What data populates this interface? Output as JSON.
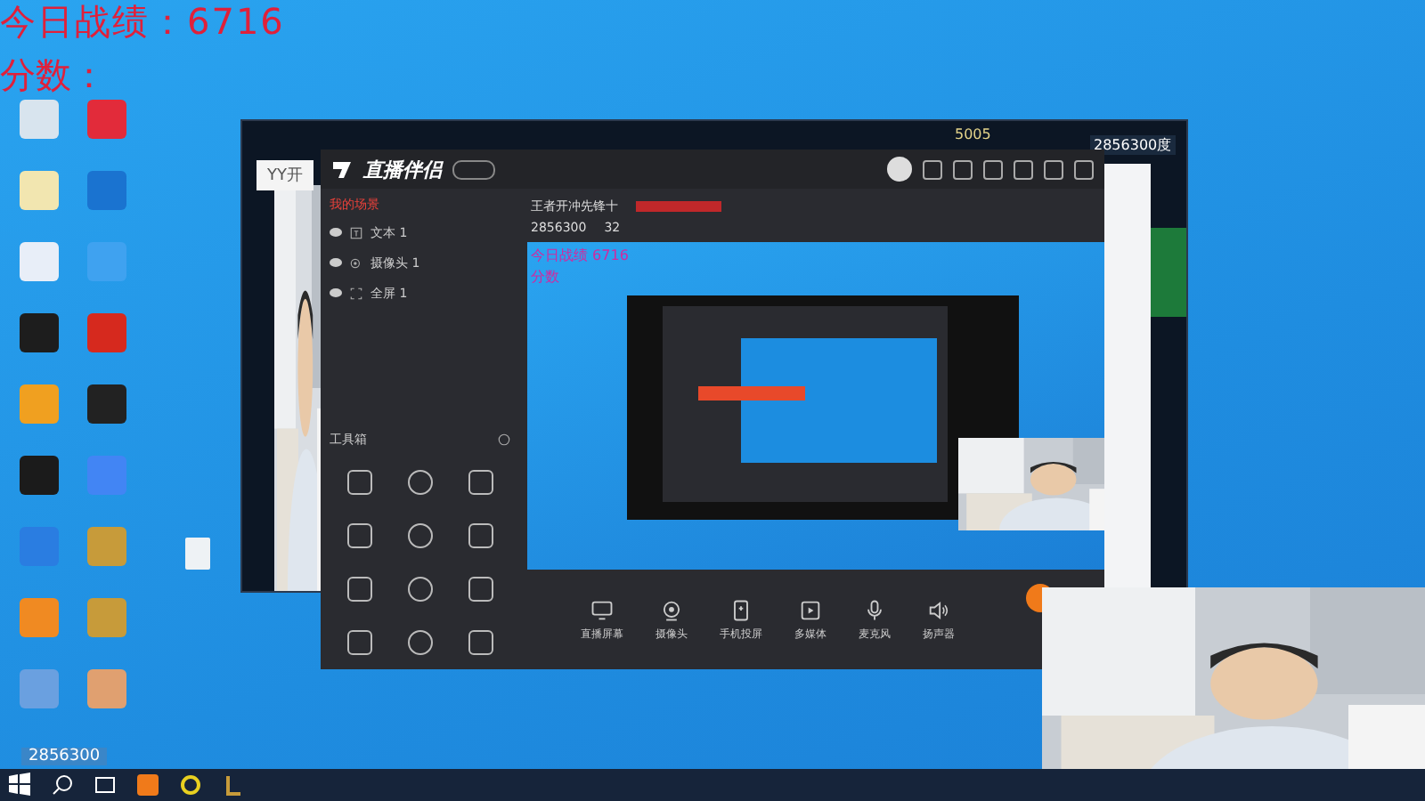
{
  "overlay": {
    "score_line": "今日战绩：6716",
    "score_label": "分数："
  },
  "desktop": {
    "note": "2856300"
  },
  "back_window": {
    "title": "YY开",
    "coins": "5005",
    "room": "2856300度"
  },
  "app": {
    "title": "直播伴侣",
    "tabs": [
      {
        "label": "我的场景",
        "selected": true
      }
    ],
    "layers": [
      {
        "label": "文本 1",
        "kind": "text",
        "visible": true
      },
      {
        "label": "摄像头 1",
        "kind": "camera",
        "visible": true
      },
      {
        "label": "全屏 1",
        "kind": "screen",
        "visible": true
      }
    ],
    "toolbox_title": "工具箱",
    "stream_title": "王者开冲先锋十",
    "room_id": "2856300",
    "viewers": "32",
    "preview": {
      "score_line": "今日战绩 6716",
      "score_label": "分数"
    },
    "controls": [
      {
        "label": "直播屏幕",
        "kind": "screen"
      },
      {
        "label": "摄像头",
        "kind": "camera"
      },
      {
        "label": "手机投屏",
        "kind": "phone"
      },
      {
        "label": "多媒体",
        "kind": "media"
      },
      {
        "label": "麦克风",
        "kind": "mic"
      },
      {
        "label": "扬声器",
        "kind": "speaker"
      }
    ]
  }
}
